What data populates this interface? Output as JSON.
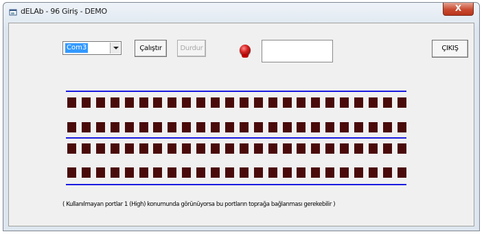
{
  "window": {
    "title": "dELAb - 96 Giriş - DEMO",
    "close_label": "X"
  },
  "toolbar": {
    "port_select": {
      "value": "Com3"
    },
    "start_label": "Çalıştır",
    "stop_label": "Durdur",
    "exit_label": "ÇIKIŞ",
    "display_value": ""
  },
  "indicator": {
    "color": "#d42020"
  },
  "ports": {
    "color": "#4a0a0a",
    "line_color": "#1a1ae0",
    "rows": 4,
    "per_row": 24
  },
  "note": "( Kullanılmayan portlar 1 (High) konumunda görünüyorsa bu portların toprağa bağlanması gerekebilir )"
}
